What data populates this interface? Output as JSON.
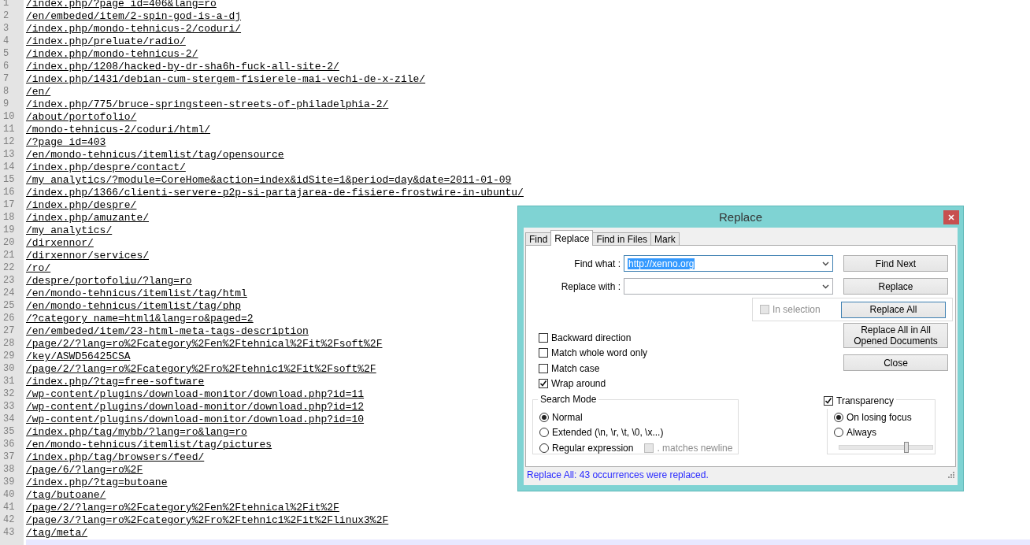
{
  "editor": {
    "lines": [
      {
        "number": "1",
        "text": "/index.php/?page_id=406&lang=ro"
      },
      {
        "number": "2",
        "text": "/en/embeded/item/2-spin-god-is-a-dj"
      },
      {
        "number": "3",
        "text": "/index.php/mondo-tehnicus-2/coduri/"
      },
      {
        "number": "4",
        "text": "/index.php/preluate/radio/"
      },
      {
        "number": "5",
        "text": "/index.php/mondo-tehnicus-2/"
      },
      {
        "number": "6",
        "text": "/index.php/1208/hacked-by-dr-sha6h-fuck-all-site-2/"
      },
      {
        "number": "7",
        "text": "/index.php/1431/debian-cum-stergem-fisierele-mai-vechi-de-x-zile/"
      },
      {
        "number": "8",
        "text": "/en/"
      },
      {
        "number": "9",
        "text": "/index.php/775/bruce-springsteen-streets-of-philadelphia-2/"
      },
      {
        "number": "10",
        "text": "/about/portofolio/"
      },
      {
        "number": "11",
        "text": "/mondo-tehnicus-2/coduri/html/"
      },
      {
        "number": "12",
        "text": "/?page_id=403"
      },
      {
        "number": "13",
        "text": "/en/mondo-tehnicus/itemlist/tag/opensource"
      },
      {
        "number": "14",
        "text": "/index.php/despre/contact/"
      },
      {
        "number": "15",
        "text": "/my_analytics/?module=CoreHome&action=index&idSite=1&period=day&date=2011-01-09"
      },
      {
        "number": "16",
        "text": "/index.php/1366/clienti-servere-p2p-si-partajarea-de-fisiere-frostwire-in-ubuntu/"
      },
      {
        "number": "17",
        "text": "/index.php/despre/"
      },
      {
        "number": "18",
        "text": "/index.php/amuzante/"
      },
      {
        "number": "19",
        "text": "/my_analytics/"
      },
      {
        "number": "20",
        "text": "/dirxennor/"
      },
      {
        "number": "21",
        "text": "/dirxennor/services/"
      },
      {
        "number": "22",
        "text": "/ro/"
      },
      {
        "number": "23",
        "text": "/despre/portofoliu/?lang=ro"
      },
      {
        "number": "24",
        "text": "/en/mondo-tehnicus/itemlist/tag/html"
      },
      {
        "number": "25",
        "text": "/en/mondo-tehnicus/itemlist/tag/php"
      },
      {
        "number": "26",
        "text": "/?category_name=html1&lang=ro&paged=2"
      },
      {
        "number": "27",
        "text": "/en/embeded/item/23-html-meta-tags-description"
      },
      {
        "number": "28",
        "text": "/page/2/?lang=ro%2Fcategory%2Fen%2Ftehnical%2Fit%2Fsoft%2F"
      },
      {
        "number": "29",
        "text": "/key/ASWD56425CSA"
      },
      {
        "number": "30",
        "text": "/page/2/?lang=ro%2Fcategory%2Fro%2Ftehnic1%2Fit%2Fsoft%2F"
      },
      {
        "number": "31",
        "text": "/index.php/?tag=free-software"
      },
      {
        "number": "32",
        "text": "/wp-content/plugins/download-monitor/download.php?id=11"
      },
      {
        "number": "33",
        "text": "/wp-content/plugins/download-monitor/download.php?id=12"
      },
      {
        "number": "34",
        "text": "/wp-content/plugins/download-monitor/download.php?id=10"
      },
      {
        "number": "35",
        "text": "/index.php/tag/mybb/?lang=ro&lang=ro"
      },
      {
        "number": "36",
        "text": "/en/mondo-tehnicus/itemlist/tag/pictures"
      },
      {
        "number": "37",
        "text": "/index.php/tag/browsers/feed/"
      },
      {
        "number": "38",
        "text": "/page/6/?lang=ro%2F"
      },
      {
        "number": "39",
        "text": "/index.php/?tag=butoane"
      },
      {
        "number": "40",
        "text": "/tag/butoane/"
      },
      {
        "number": "41",
        "text": "/page/2/?lang=ro%2Fcategory%2Fen%2Ftehnical%2Fit%2F"
      },
      {
        "number": "42",
        "text": "/page/3/?lang=ro%2Fcategory%2Fro%2Ftehnic1%2Fit%2Flinux3%2F"
      },
      {
        "number": "43",
        "text": "/tag/meta/"
      }
    ]
  },
  "dialog": {
    "title": "Replace",
    "tabs": [
      {
        "label": "Find",
        "selected": false
      },
      {
        "label": "Replace",
        "selected": true
      },
      {
        "label": "Find in Files",
        "selected": false
      },
      {
        "label": "Mark",
        "selected": false
      }
    ],
    "find_what": {
      "label": "Find what :",
      "value": "http://xenno.org",
      "highlighted": true
    },
    "replace_with": {
      "label": "Replace with :"
    },
    "in_selection": {
      "label": "In selection",
      "checked": false,
      "disabled": true
    },
    "buttons": [
      {
        "label": "Find Next",
        "focused": false
      },
      {
        "label": "Replace",
        "focused": false
      },
      {
        "label": "Replace All",
        "focused": true
      },
      {
        "label": "Replace All in All Opened Documents",
        "focused": false
      },
      {
        "label": "Close",
        "focused": false
      }
    ],
    "options": [
      {
        "label": "Backward direction",
        "checked": false
      },
      {
        "label": "Match whole word only",
        "checked": false
      },
      {
        "label": "Match case",
        "checked": false
      },
      {
        "label": "Wrap around",
        "checked": true
      }
    ],
    "search_mode": {
      "title": "Search Mode",
      "options": [
        {
          "label": "Normal",
          "selected": true
        },
        {
          "label": "Extended (\\n, \\r, \\t, \\0, \\x...)",
          "selected": false
        },
        {
          "label": "Regular expression",
          "selected": false
        }
      ],
      "matches_newline": {
        "label": ". matches newline",
        "checked": false,
        "disabled": true
      }
    },
    "transparency": {
      "label": "Transparency",
      "checked": true,
      "options": [
        {
          "label": "On losing focus",
          "selected": true
        },
        {
          "label": "Always",
          "selected": false
        }
      ],
      "level": 0.72
    },
    "status": "Replace All: 43 occurrences were replaced."
  }
}
